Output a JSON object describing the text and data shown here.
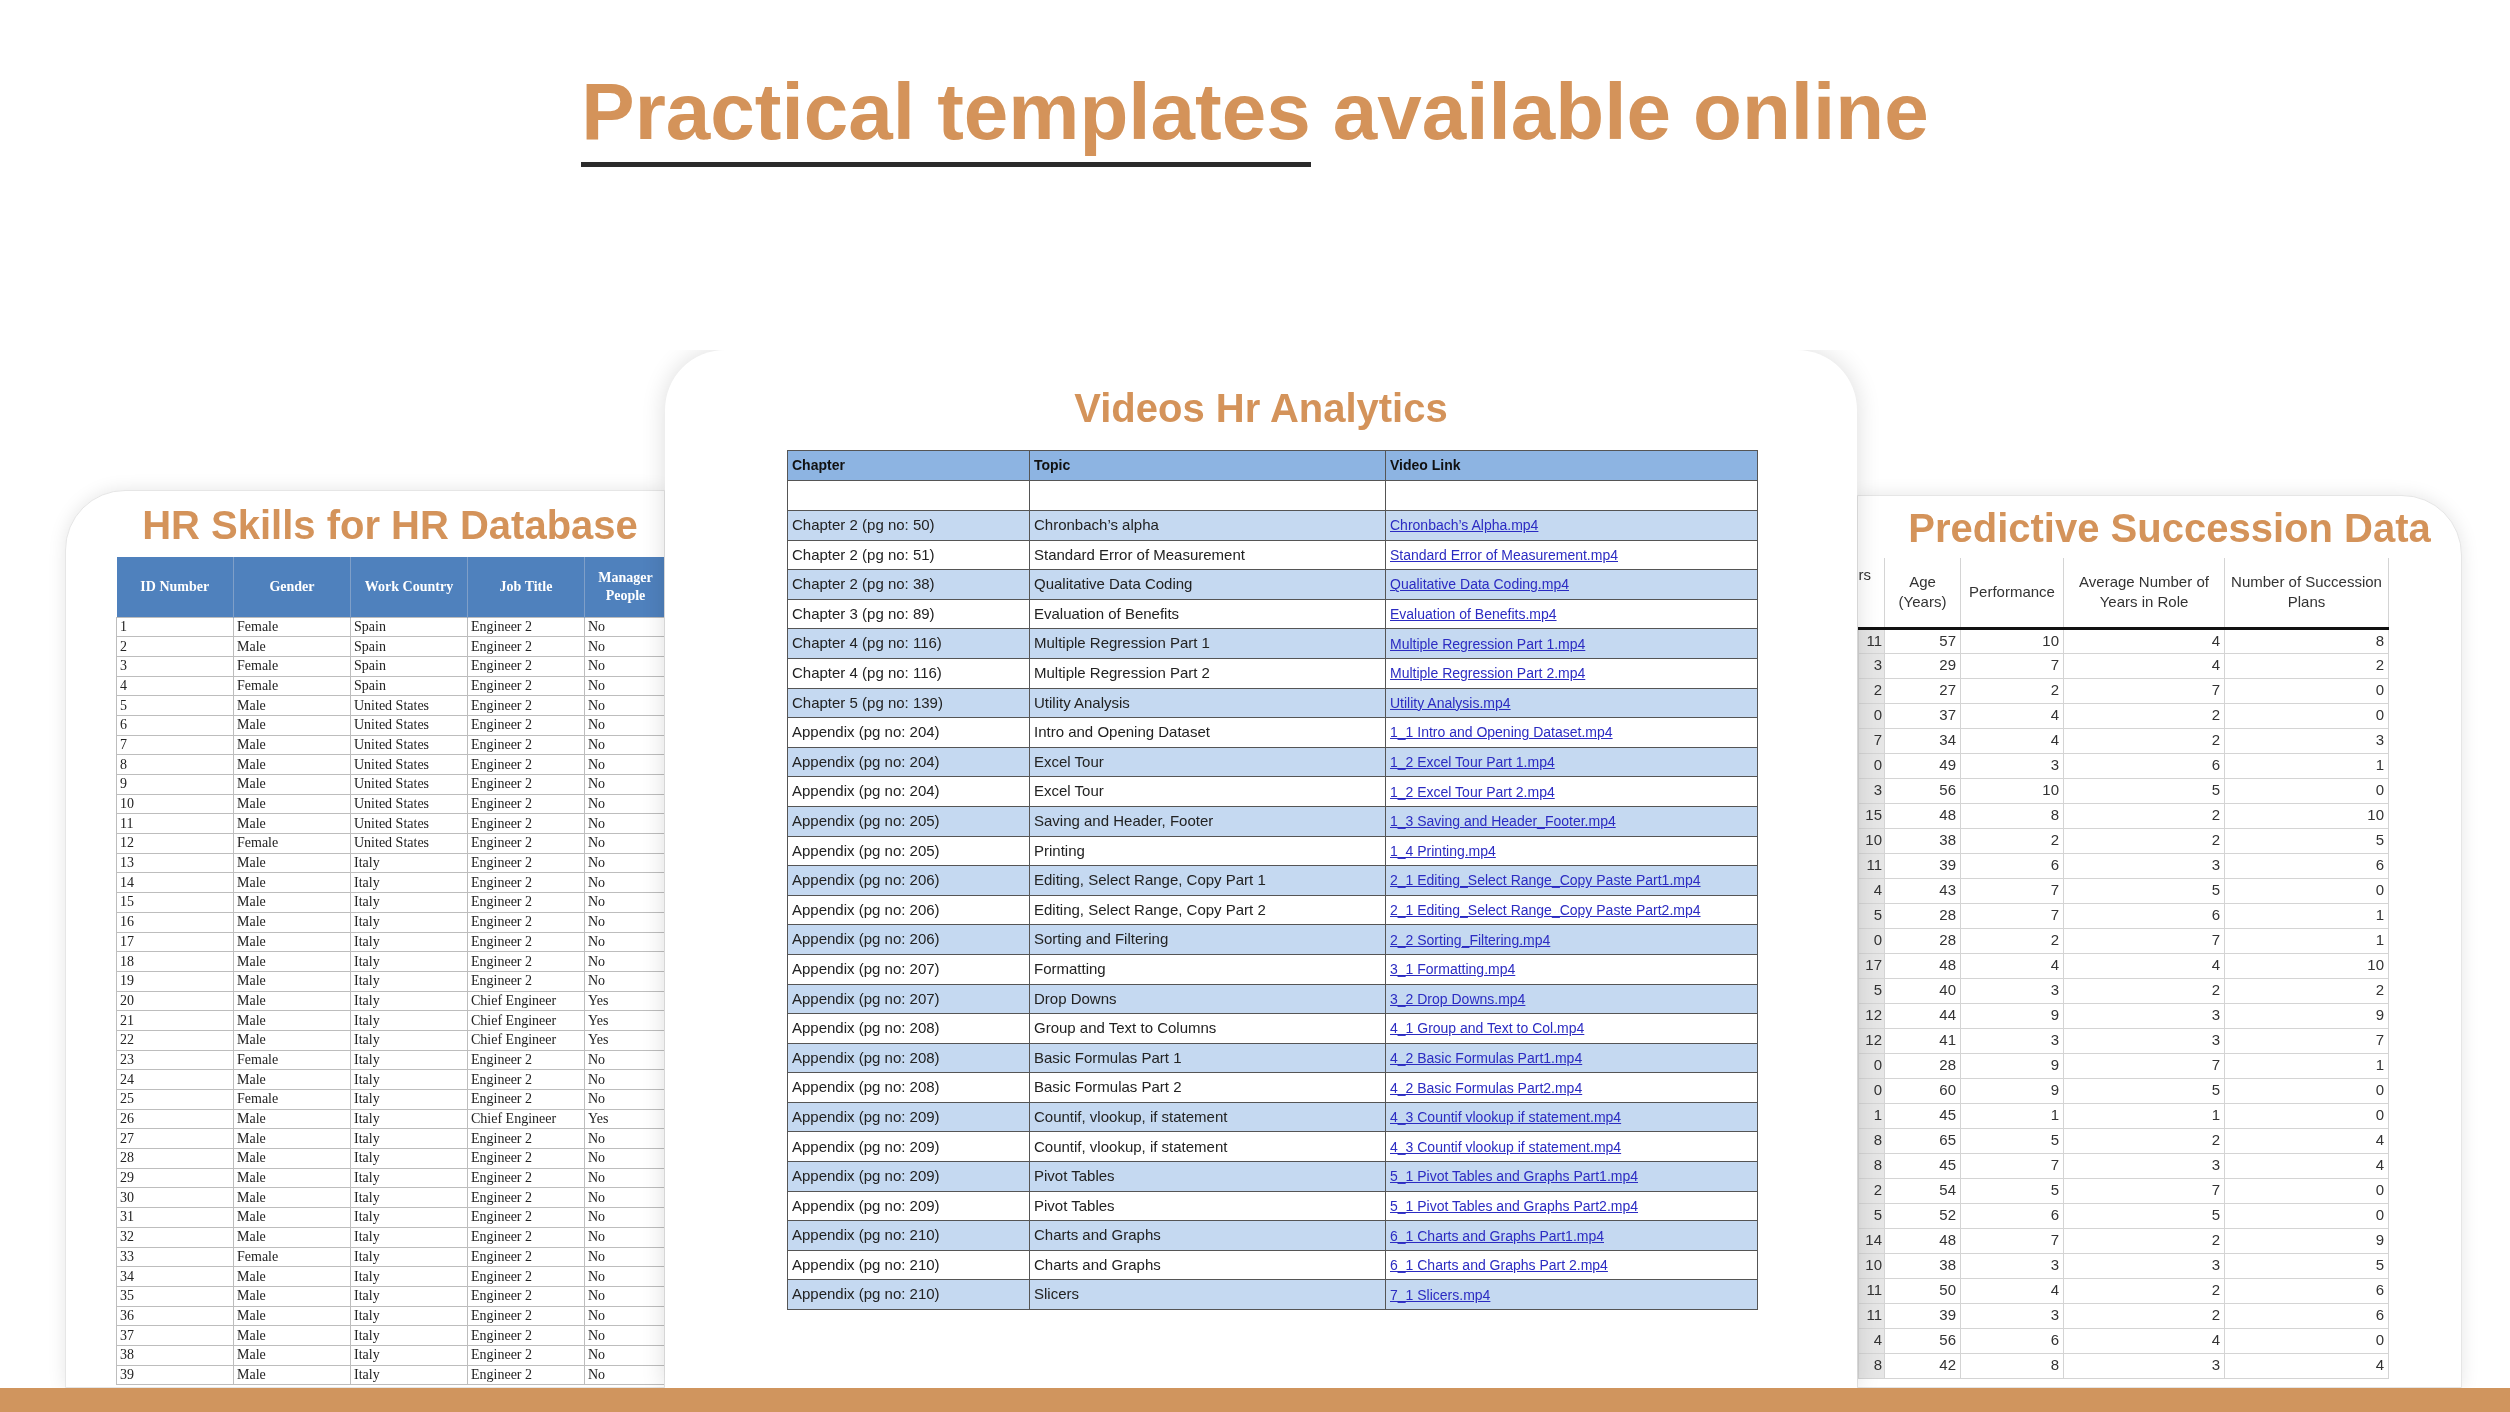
{
  "title_segments": [
    {
      "text": "Practical templates",
      "underlined": true
    },
    {
      "text": "available online",
      "underlined": false
    }
  ],
  "panels": [
    {
      "kind": "hr_database",
      "title": "HR Skills for HR Database",
      "columns": [
        "ID Number",
        "Gender",
        "Work Country",
        "Job Title",
        "Manager People"
      ],
      "rows": [
        [
          "1",
          "Female",
          "Spain",
          "Engineer 2",
          "No"
        ],
        [
          "2",
          "Male",
          "Spain",
          "Engineer 2",
          "No"
        ],
        [
          "3",
          "Female",
          "Spain",
          "Engineer 2",
          "No"
        ],
        [
          "4",
          "Female",
          "Spain",
          "Engineer 2",
          "No"
        ],
        [
          "5",
          "Male",
          "United States",
          "Engineer 2",
          "No"
        ],
        [
          "6",
          "Male",
          "United States",
          "Engineer 2",
          "No"
        ],
        [
          "7",
          "Male",
          "United States",
          "Engineer 2",
          "No"
        ],
        [
          "8",
          "Male",
          "United States",
          "Engineer 2",
          "No"
        ],
        [
          "9",
          "Male",
          "United States",
          "Engineer 2",
          "No"
        ],
        [
          "10",
          "Male",
          "United States",
          "Engineer 2",
          "No"
        ],
        [
          "11",
          "Male",
          "United States",
          "Engineer 2",
          "No"
        ],
        [
          "12",
          "Female",
          "United States",
          "Engineer 2",
          "No"
        ],
        [
          "13",
          "Male",
          "Italy",
          "Engineer 2",
          "No"
        ],
        [
          "14",
          "Male",
          "Italy",
          "Engineer 2",
          "No"
        ],
        [
          "15",
          "Male",
          "Italy",
          "Engineer 2",
          "No"
        ],
        [
          "16",
          "Male",
          "Italy",
          "Engineer 2",
          "No"
        ],
        [
          "17",
          "Male",
          "Italy",
          "Engineer 2",
          "No"
        ],
        [
          "18",
          "Male",
          "Italy",
          "Engineer 2",
          "No"
        ],
        [
          "19",
          "Male",
          "Italy",
          "Engineer 2",
          "No"
        ],
        [
          "20",
          "Male",
          "Italy",
          "Chief Engineer",
          "Yes"
        ],
        [
          "21",
          "Male",
          "Italy",
          "Chief Engineer",
          "Yes"
        ],
        [
          "22",
          "Male",
          "Italy",
          "Chief Engineer",
          "Yes"
        ],
        [
          "23",
          "Female",
          "Italy",
          "Engineer 2",
          "No"
        ],
        [
          "24",
          "Male",
          "Italy",
          "Engineer 2",
          "No"
        ],
        [
          "25",
          "Female",
          "Italy",
          "Engineer 2",
          "No"
        ],
        [
          "26",
          "Male",
          "Italy",
          "Chief Engineer",
          "Yes"
        ],
        [
          "27",
          "Male",
          "Italy",
          "Engineer 2",
          "No"
        ],
        [
          "28",
          "Male",
          "Italy",
          "Engineer 2",
          "No"
        ],
        [
          "29",
          "Male",
          "Italy",
          "Engineer 2",
          "No"
        ],
        [
          "30",
          "Male",
          "Italy",
          "Engineer 2",
          "No"
        ],
        [
          "31",
          "Male",
          "Italy",
          "Engineer 2",
          "No"
        ],
        [
          "32",
          "Male",
          "Italy",
          "Engineer 2",
          "No"
        ],
        [
          "33",
          "Female",
          "Italy",
          "Engineer 2",
          "No"
        ],
        [
          "34",
          "Male",
          "Italy",
          "Engineer 2",
          "No"
        ],
        [
          "35",
          "Male",
          "Italy",
          "Engineer 2",
          "No"
        ],
        [
          "36",
          "Male",
          "Italy",
          "Engineer 2",
          "No"
        ],
        [
          "37",
          "Male",
          "Italy",
          "Engineer 2",
          "No"
        ],
        [
          "38",
          "Male",
          "Italy",
          "Engineer 2",
          "No"
        ],
        [
          "39",
          "Male",
          "Italy",
          "Engineer 2",
          "No"
        ]
      ]
    },
    {
      "kind": "videos",
      "title": "Videos Hr Analytics",
      "columns": [
        "Chapter",
        "Topic",
        "Video Link"
      ],
      "rows": [
        [
          "Chapter 2 (pg no: 50)",
          "Chronbach’s alpha",
          "Chronbach’s Alpha.mp4"
        ],
        [
          "Chapter 2 (pg no: 51)",
          "Standard Error of Measurement",
          "Standard Error of Measurement.mp4"
        ],
        [
          "Chapter 2 (pg no: 38)",
          "Qualitative Data Coding",
          "Qualitative Data Coding.mp4"
        ],
        [
          "Chapter 3 (pg no: 89)",
          "Evaluation of Benefits",
          "Evaluation of Benefits.mp4"
        ],
        [
          "Chapter 4 (pg no: 116)",
          "Multiple Regression Part 1",
          "Multiple Regression Part 1.mp4"
        ],
        [
          "Chapter 4 (pg no: 116)",
          "Multiple Regression Part 2",
          "Multiple Regression Part 2.mp4"
        ],
        [
          "Chapter 5 (pg no: 139)",
          "Utility Analysis",
          "Utility Analysis.mp4"
        ],
        [
          "Appendix (pg no: 204)",
          "Intro and Opening Dataset",
          "1_1 Intro and Opening Dataset.mp4"
        ],
        [
          "Appendix (pg no: 204)",
          "Excel Tour",
          "1_2 Excel Tour Part 1.mp4"
        ],
        [
          "Appendix (pg no: 204)",
          "Excel Tour",
          "1_2 Excel Tour Part 2.mp4"
        ],
        [
          "Appendix (pg no: 205)",
          "Saving and Header, Footer",
          "1_3 Saving and Header_Footer.mp4"
        ],
        [
          "Appendix (pg no: 205)",
          "Printing",
          "1_4 Printing.mp4"
        ],
        [
          "Appendix (pg no: 206)",
          "Editing, Select Range, Copy Part 1",
          "2_1 Editing_Select Range_Copy Paste Part1.mp4"
        ],
        [
          "Appendix (pg no: 206)",
          "Editing, Select Range, Copy Part 2",
          "2_1 Editing_Select Range_Copy Paste Part2.mp4"
        ],
        [
          "Appendix (pg no: 206)",
          "Sorting and Filtering",
          "2_2 Sorting_Filtering.mp4"
        ],
        [
          "Appendix (pg no: 207)",
          "Formatting",
          "3_1 Formatting.mp4"
        ],
        [
          "Appendix (pg no: 207)",
          "Drop Downs",
          "3_2 Drop Downs.mp4"
        ],
        [
          "Appendix (pg no: 208)",
          "Group and Text to Columns",
          "4_1 Group and Text to Col.mp4"
        ],
        [
          "Appendix (pg no: 208)",
          "Basic Formulas Part 1",
          "4_2 Basic Formulas Part1.mp4"
        ],
        [
          "Appendix (pg no: 208)",
          "Basic Formulas Part 2",
          "4_2 Basic Formulas Part2.mp4"
        ],
        [
          "Appendix (pg no: 209)",
          "Countif, vlookup, if statement",
          "4_3 Countif vlookup if statement.mp4"
        ],
        [
          "Appendix (pg no: 209)",
          "Countif, vlookup, if statement",
          "4_3 Countif vlookup if statement.mp4"
        ],
        [
          "Appendix (pg no: 209)",
          "Pivot Tables",
          "5_1 Pivot Tables and Graphs Part1.mp4"
        ],
        [
          "Appendix (pg no: 209)",
          "Pivot Tables",
          "5_1 Pivot Tables and Graphs Part2.mp4"
        ],
        [
          "Appendix (pg no: 210)",
          "Charts and Graphs",
          "6_1 Charts and Graphs Part1.mp4"
        ],
        [
          "Appendix (pg no: 210)",
          "Charts and Graphs",
          "6_1 Charts and Graphs Part 2.mp4"
        ],
        [
          "Appendix (pg no: 210)",
          "Slicers",
          "7_1 Slicers.mp4"
        ]
      ]
    },
    {
      "kind": "succession",
      "title": "Predictive Succession Data",
      "columns": [
        "rs",
        "Age (Years)",
        "Performance",
        "Average Number of Years in Role",
        "Number of Succession Plans"
      ],
      "rows": [
        [
          "11",
          "57",
          "10",
          "4",
          "8"
        ],
        [
          "3",
          "29",
          "7",
          "4",
          "2"
        ],
        [
          "2",
          "27",
          "2",
          "7",
          "0"
        ],
        [
          "0",
          "37",
          "4",
          "2",
          "0"
        ],
        [
          "7",
          "34",
          "4",
          "2",
          "3"
        ],
        [
          "0",
          "49",
          "3",
          "6",
          "1"
        ],
        [
          "3",
          "56",
          "10",
          "5",
          "0"
        ],
        [
          "15",
          "48",
          "8",
          "2",
          "10"
        ],
        [
          "10",
          "38",
          "2",
          "2",
          "5"
        ],
        [
          "11",
          "39",
          "6",
          "3",
          "6"
        ],
        [
          "4",
          "43",
          "7",
          "5",
          "0"
        ],
        [
          "5",
          "28",
          "7",
          "6",
          "1"
        ],
        [
          "0",
          "28",
          "2",
          "7",
          "1"
        ],
        [
          "17",
          "48",
          "4",
          "4",
          "10"
        ],
        [
          "5",
          "40",
          "3",
          "2",
          "2"
        ],
        [
          "12",
          "44",
          "9",
          "3",
          "9"
        ],
        [
          "12",
          "41",
          "3",
          "3",
          "7"
        ],
        [
          "0",
          "28",
          "9",
          "7",
          "1"
        ],
        [
          "0",
          "60",
          "9",
          "5",
          "0"
        ],
        [
          "1",
          "45",
          "1",
          "1",
          "0"
        ],
        [
          "8",
          "65",
          "5",
          "2",
          "4"
        ],
        [
          "8",
          "45",
          "7",
          "3",
          "4"
        ],
        [
          "2",
          "54",
          "5",
          "7",
          "0"
        ],
        [
          "5",
          "52",
          "6",
          "5",
          "0"
        ],
        [
          "14",
          "48",
          "7",
          "2",
          "9"
        ],
        [
          "10",
          "38",
          "3",
          "3",
          "5"
        ],
        [
          "11",
          "50",
          "4",
          "2",
          "6"
        ],
        [
          "11",
          "39",
          "3",
          "2",
          "6"
        ],
        [
          "4",
          "56",
          "6",
          "4",
          "0"
        ],
        [
          "8",
          "42",
          "8",
          "3",
          "4"
        ]
      ]
    }
  ]
}
